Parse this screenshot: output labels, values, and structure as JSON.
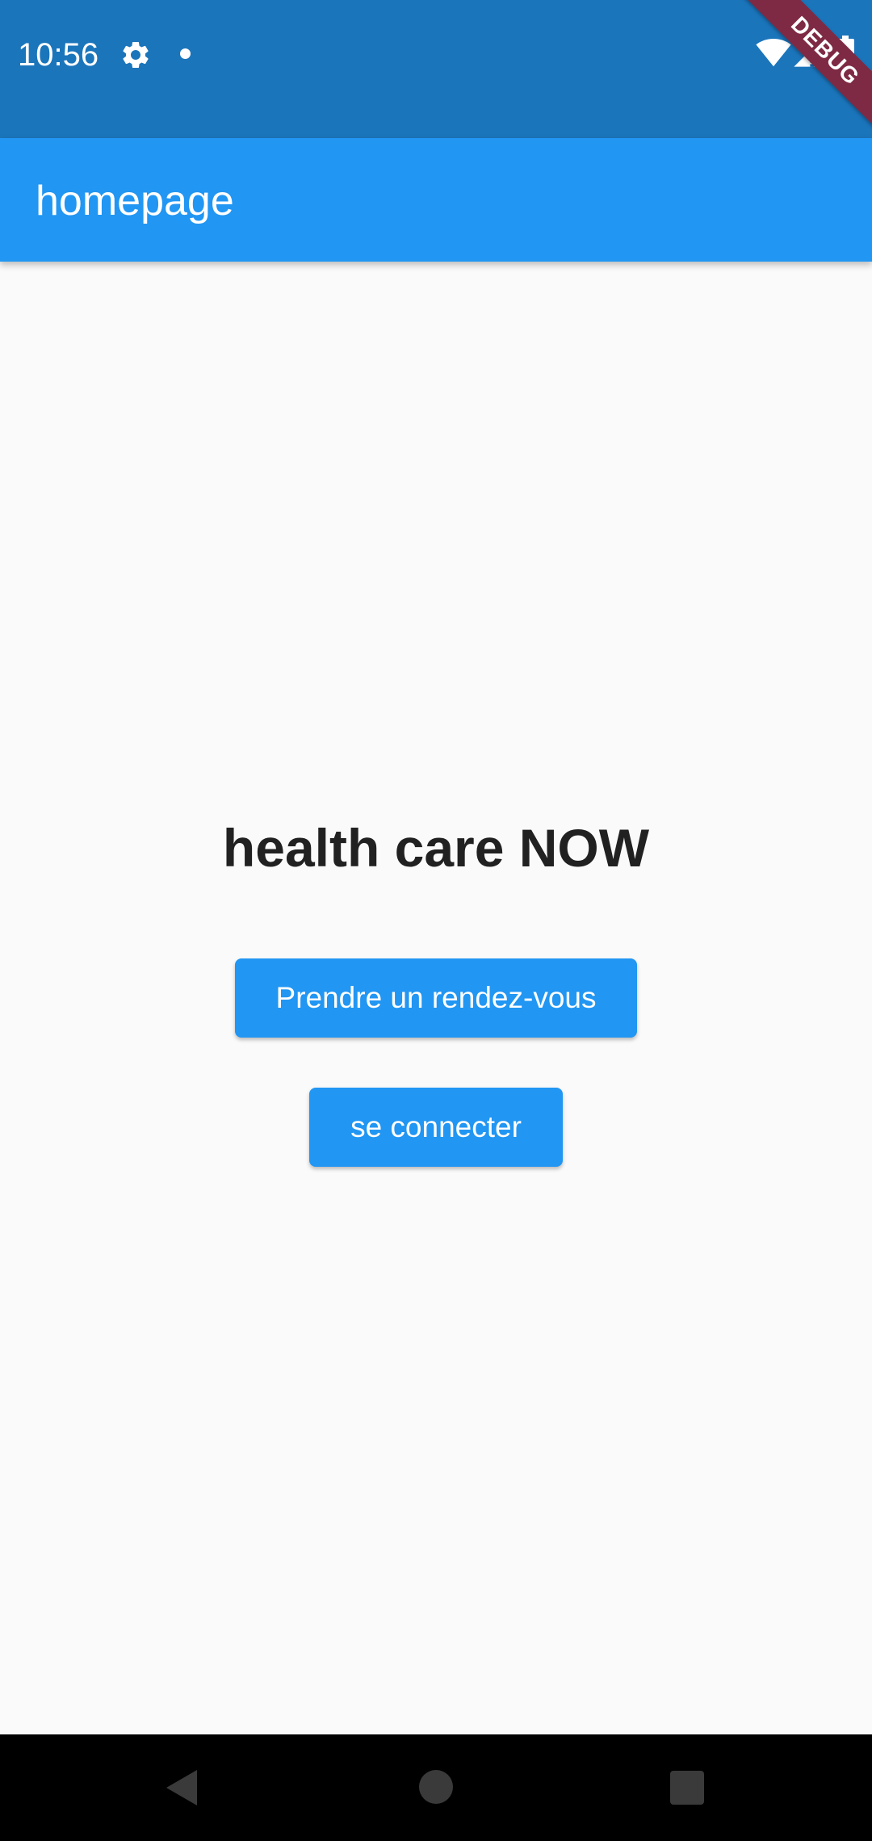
{
  "status_bar": {
    "time": "10:56",
    "icons": [
      "gear-icon",
      "notification-dot-icon",
      "wifi-icon",
      "signal-icon",
      "battery-icon"
    ]
  },
  "debug_banner": "DEBUG",
  "app_bar": {
    "title": "homepage"
  },
  "main": {
    "title": "health care NOW",
    "buttons": {
      "appointment": "Prendre un rendez-vous",
      "login": "se connecter"
    }
  },
  "nav_bar": {
    "icons": [
      "back-icon",
      "home-icon",
      "recents-icon"
    ]
  },
  "colors": {
    "status_bar": "#1b75bb",
    "app_bar": "#2196f3",
    "button": "#2196f3",
    "background": "#fafafa",
    "debug_banner": "#7e2a44"
  }
}
